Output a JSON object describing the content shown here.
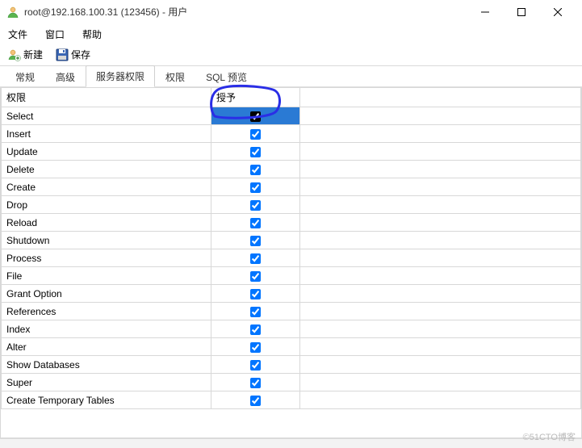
{
  "window": {
    "title": "root@192.168.100.31 (123456) - 用户"
  },
  "menubar": {
    "file": "文件",
    "window": "窗口",
    "help": "帮助"
  },
  "toolbar": {
    "new_label": "新建",
    "save_label": "保存"
  },
  "tabs": [
    {
      "label": "常规",
      "active": false
    },
    {
      "label": "高级",
      "active": false
    },
    {
      "label": "服务器权限",
      "active": true
    },
    {
      "label": "权限",
      "active": false
    },
    {
      "label": "SQL 预览",
      "active": false
    }
  ],
  "table": {
    "header_permission": "权限",
    "header_grant": "授予",
    "rows": [
      {
        "name": "Select",
        "granted": true,
        "selected": true
      },
      {
        "name": "Insert",
        "granted": true
      },
      {
        "name": "Update",
        "granted": true
      },
      {
        "name": "Delete",
        "granted": true
      },
      {
        "name": "Create",
        "granted": true
      },
      {
        "name": "Drop",
        "granted": true
      },
      {
        "name": "Reload",
        "granted": true
      },
      {
        "name": "Shutdown",
        "granted": true
      },
      {
        "name": "Process",
        "granted": true
      },
      {
        "name": "File",
        "granted": true
      },
      {
        "name": "Grant Option",
        "granted": true
      },
      {
        "name": "References",
        "granted": true
      },
      {
        "name": "Index",
        "granted": true
      },
      {
        "name": "Alter",
        "granted": true
      },
      {
        "name": "Show Databases",
        "granted": true
      },
      {
        "name": "Super",
        "granted": true
      },
      {
        "name": "Create Temporary Tables",
        "granted": true
      }
    ]
  },
  "watermark": "©51CTO博客"
}
